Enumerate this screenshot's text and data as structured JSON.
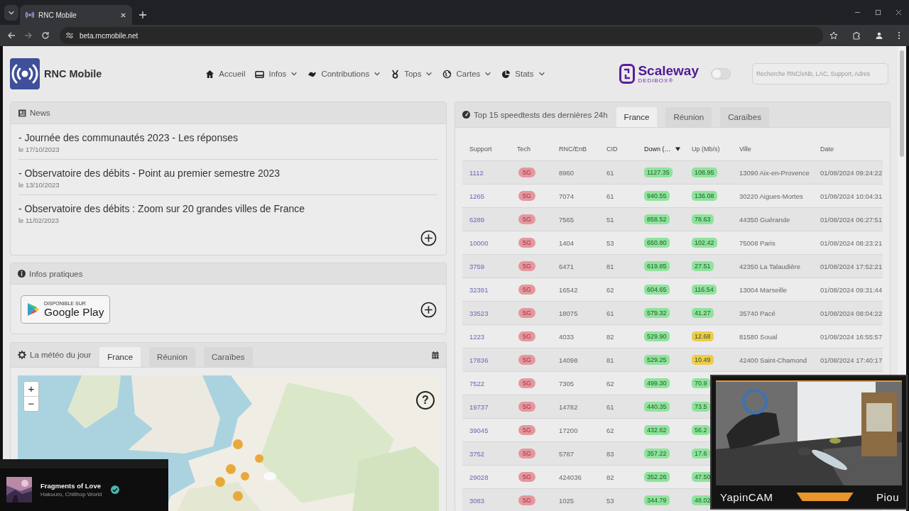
{
  "browser": {
    "tab_title": "RNC Mobile",
    "address": "beta.rncmobile.net"
  },
  "header": {
    "brand": "RNC Mobile",
    "nav": [
      {
        "label": "Accueil",
        "has_menu": false
      },
      {
        "label": "Infos",
        "has_menu": true
      },
      {
        "label": "Contributions",
        "has_menu": true
      },
      {
        "label": "Tops",
        "has_menu": true
      },
      {
        "label": "Cartes",
        "has_menu": true
      },
      {
        "label": "Stats",
        "has_menu": true
      }
    ],
    "sponsor": {
      "name": "Scaleway",
      "sub": "DEDIBOX®"
    },
    "theme_toggle": {
      "on": false
    },
    "search": {
      "placeholder": "Recherche RNC/eNb, LAC, Support, Adres"
    }
  },
  "news": {
    "title": "News",
    "items": [
      {
        "title": "- Journée des communautés 2023 - Les réponses",
        "date": "le 17/10/2023"
      },
      {
        "title": "- Observatoire des débits - Point au premier semestre 2023",
        "date": "le 13/10/2023"
      },
      {
        "title": "- Observatoire des débits : Zoom sur 20 grandes villes de France",
        "date": "le 11/02/2023"
      }
    ]
  },
  "infos": {
    "title": "Infos pratiques",
    "store_badge": {
      "line1": "DISPONIBLE SUR",
      "line2": "Google Play"
    }
  },
  "meteo": {
    "title": "La météo du jour",
    "tabs": [
      {
        "label": "France",
        "selected": true
      },
      {
        "label": "Réunion",
        "selected": false
      },
      {
        "label": "Caraïbes",
        "selected": false
      }
    ],
    "map": {
      "kind": "picture",
      "zoom_in": "+",
      "zoom_out": "−",
      "help": "?"
    }
  },
  "speedtests": {
    "title": "Top 15 speedtests des dernières 24h",
    "tabs": [
      {
        "label": "France",
        "selected": true
      },
      {
        "label": "Réunion",
        "selected": false
      },
      {
        "label": "Caraïbes",
        "selected": false
      }
    ],
    "columns": [
      {
        "label": "Support",
        "sorted": false
      },
      {
        "label": "Tech",
        "sorted": false
      },
      {
        "label": "RNC/EnB",
        "sorted": false
      },
      {
        "label": "CID",
        "sorted": false
      },
      {
        "label": "Down (…",
        "sorted": true
      },
      {
        "label": "Up (Mb/s)",
        "sorted": false
      },
      {
        "label": "Ville",
        "sorted": false
      },
      {
        "label": "Date",
        "sorted": false
      }
    ],
    "rows": [
      {
        "support": "1112",
        "tech": "5G",
        "rnc": "8960",
        "cid": "61",
        "down": {
          "value": "1127.35",
          "color": "#8fe39c"
        },
        "up": {
          "value": "108.95",
          "color": "#8fe39c"
        },
        "ville": "13090 Aix-en-Provence",
        "date": "01/08/2024 09:24:22"
      },
      {
        "support": "1265",
        "tech": "5G",
        "rnc": "7074",
        "cid": "61",
        "down": {
          "value": "940.55",
          "color": "#8fe39c"
        },
        "up": {
          "value": "136.08",
          "color": "#8fe39c"
        },
        "ville": "30220 Aigues-Mortes",
        "date": "01/08/2024 10:04:31"
      },
      {
        "support": "6289",
        "tech": "5G",
        "rnc": "7565",
        "cid": "51",
        "down": {
          "value": "858.52",
          "color": "#8fe39c"
        },
        "up": {
          "value": "78.63",
          "color": "#8fe39c"
        },
        "ville": "44350 Guérande",
        "date": "01/08/2024 06:27:51"
      },
      {
        "support": "10000",
        "tech": "5G",
        "rnc": "1404",
        "cid": "53",
        "down": {
          "value": "650.80",
          "color": "#8fe39c"
        },
        "up": {
          "value": "102.42",
          "color": "#8fe39c"
        },
        "ville": "75008 Paris",
        "date": "01/08/2024 08:23:21"
      },
      {
        "support": "3759",
        "tech": "5G",
        "rnc": "6471",
        "cid": "81",
        "down": {
          "value": "619.85",
          "color": "#8fe39c"
        },
        "up": {
          "value": "27.51",
          "color": "#8fe39c"
        },
        "ville": "42350 La Talaudière",
        "date": "01/08/2024 17:52:21"
      },
      {
        "support": "32391",
        "tech": "5G",
        "rnc": "16542",
        "cid": "62",
        "down": {
          "value": "604.65",
          "color": "#8fe39c"
        },
        "up": {
          "value": "116.54",
          "color": "#8fe39c"
        },
        "ville": "13004 Marseille",
        "date": "01/08/2024 09:31:44"
      },
      {
        "support": "33523",
        "tech": "5G",
        "rnc": "18075",
        "cid": "61",
        "down": {
          "value": "579.32",
          "color": "#8fe39c"
        },
        "up": {
          "value": "41.27",
          "color": "#8fe39c"
        },
        "ville": "35740 Pacé",
        "date": "01/08/2024 08:04:22"
      },
      {
        "support": "1223",
        "tech": "5G",
        "rnc": "4033",
        "cid": "82",
        "down": {
          "value": "529.90",
          "color": "#8fe39c"
        },
        "up": {
          "value": "12.68",
          "color": "#f0cb4a"
        },
        "ville": "81580 Soual",
        "date": "01/08/2024 16:55:57"
      },
      {
        "support": "17836",
        "tech": "5G",
        "rnc": "14098",
        "cid": "81",
        "down": {
          "value": "529.25",
          "color": "#8fe39c"
        },
        "up": {
          "value": "10.49",
          "color": "#f0cb4a"
        },
        "ville": "42400 Saint-Chamond",
        "date": "01/08/2024 17:40:17"
      },
      {
        "support": "7522",
        "tech": "5G",
        "rnc": "7305",
        "cid": "62",
        "down": {
          "value": "499.30",
          "color": "#8fe39c"
        },
        "up": {
          "value": "70.9",
          "color": "#8fe39c"
        }
      },
      {
        "support": "19737",
        "tech": "5G",
        "rnc": "14782",
        "cid": "61",
        "down": {
          "value": "440.35",
          "color": "#8fe39c"
        },
        "up": {
          "value": "73.5",
          "color": "#8fe39c"
        }
      },
      {
        "support": "39045",
        "tech": "5G",
        "rnc": "17200",
        "cid": "62",
        "down": {
          "value": "432.62",
          "color": "#8fe39c"
        },
        "up": {
          "value": "56.2",
          "color": "#8fe39c"
        }
      },
      {
        "support": "3752",
        "tech": "5G",
        "rnc": "5787",
        "cid": "83",
        "down": {
          "value": "357.22",
          "color": "#8fe39c"
        },
        "up": {
          "value": "17.6",
          "color": "#8fe39c"
        }
      },
      {
        "support": "29028",
        "tech": "5G",
        "rnc": "424036",
        "cid": "82",
        "down": {
          "value": "352.26",
          "color": "#8fe39c"
        },
        "up": {
          "value": "47.50",
          "color": "#8fe39c"
        }
      },
      {
        "support": "3083",
        "tech": "5G",
        "rnc": "1025",
        "cid": "53",
        "down": {
          "value": "344.79",
          "color": "#8fe39c"
        },
        "up": {
          "value": "48.02",
          "color": "#8fe39c"
        }
      }
    ]
  },
  "music": {
    "title": "Fragments of Love",
    "artist": "Hakuuro, Chillhop World"
  },
  "webcam": {
    "name": "YapinCAM",
    "label": "Piou"
  }
}
